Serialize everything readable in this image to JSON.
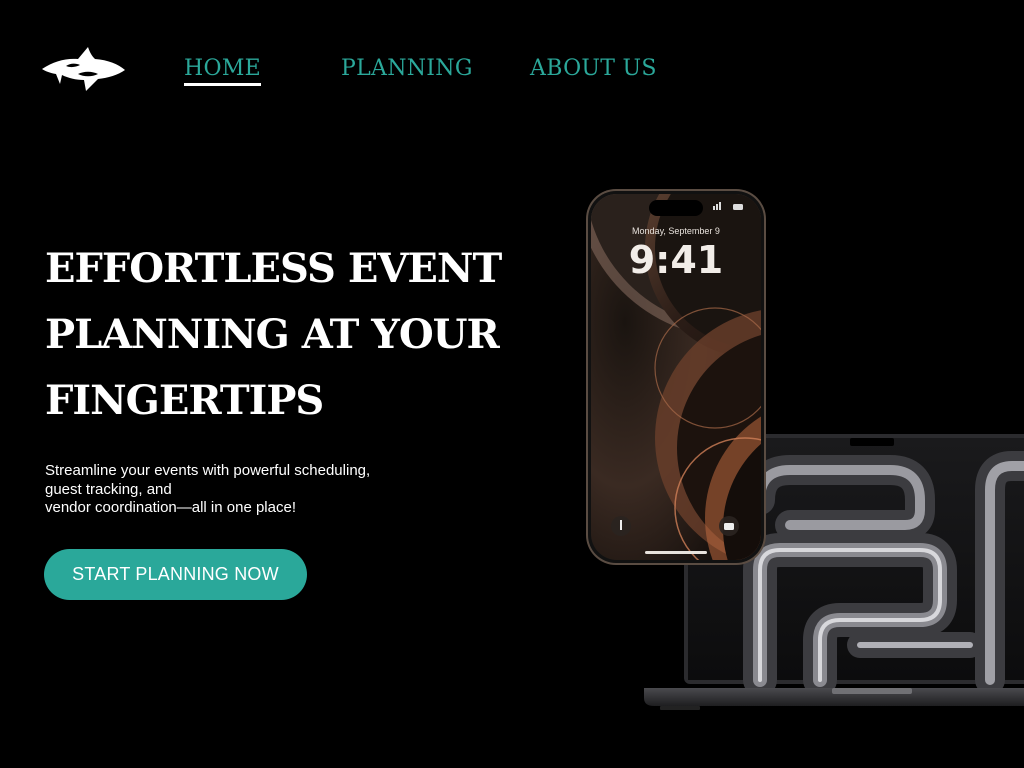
{
  "brand": {
    "logo_icon": "shark-icon"
  },
  "nav": {
    "items": [
      {
        "label": "HOME",
        "active": true
      },
      {
        "label": "PLANNING",
        "active": false
      },
      {
        "label": "ABOUT US",
        "active": false
      }
    ]
  },
  "hero": {
    "headline": "EFFORTLESS EVENT PLANNING AT YOUR FINGERTIPS",
    "subtext_lines": [
      "Streamline your events with powerful scheduling,",
      "guest tracking, and",
      "vendor coordination—all in one place!"
    ],
    "cta_label": "START PLANNING NOW"
  },
  "phone": {
    "date": "Monday, September 9",
    "time": "9:41"
  },
  "colors": {
    "background": "#000000",
    "accent": "#2aa89a",
    "text": "#ffffff"
  }
}
